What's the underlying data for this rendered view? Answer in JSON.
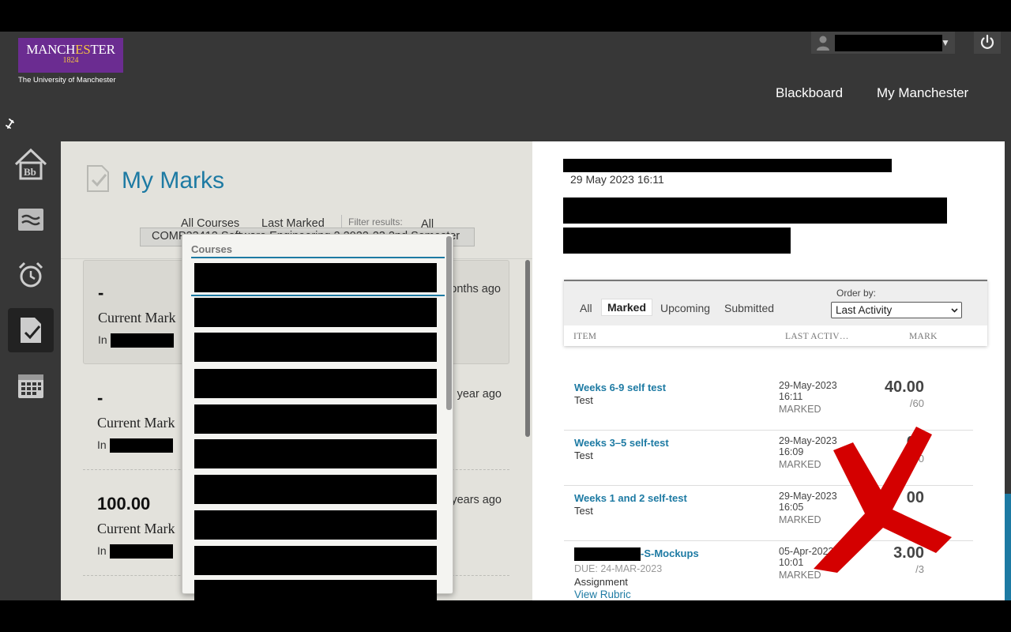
{
  "header": {
    "logo": {
      "main": "MANCHESTER",
      "year": "1824",
      "subtitle": "The University of Manchester"
    },
    "nav": {
      "blackboard": "Blackboard",
      "my_manchester": "My Manchester"
    }
  },
  "rail": {
    "items": [
      "home-icon",
      "stream-icon",
      "alarm-icon",
      "grades-icon",
      "calendar-icon"
    ],
    "active": "grades-icon"
  },
  "marks": {
    "title": "My Marks",
    "filters": {
      "all_courses": "All Courses",
      "last_marked": "Last Marked",
      "filter_label": "Filter results:",
      "filter_value": "All"
    },
    "course_select": "COMP23412 Software Engineering 2 2022-23 2nd Semester",
    "cards": [
      {
        "value": "-",
        "label": "Current Mark",
        "in": "In",
        "ago": "months ago"
      },
      {
        "value": "-",
        "label": "Current Mark",
        "in": "In",
        "ago": "year ago"
      },
      {
        "value": "100.00",
        "label": "Current Mark",
        "in": "In",
        "ago": "years ago"
      }
    ],
    "dropdown": {
      "title": "Courses"
    }
  },
  "detail": {
    "date": "29 May 2023 16:11",
    "tabs": {
      "all": "All",
      "marked": "Marked",
      "upcoming": "Upcoming",
      "submitted": "Submitted"
    },
    "order_by": {
      "label": "Order by:",
      "value": "Last Activity"
    },
    "columns": {
      "item": "ITEM",
      "last_activity": "LAST ACTIV…",
      "mark": "MARK"
    },
    "rows": [
      {
        "title": "Weeks 6-9 self test",
        "type": "Test",
        "date": "29-May-2023",
        "time": "16:11",
        "status": "MARKED",
        "score": "40.00",
        "out_of": "/60"
      },
      {
        "title": "Weeks 3–5 self-test",
        "type": "Test",
        "date": "29-May-2023",
        "time": "16:09",
        "status": "MARKED",
        "score": "00",
        "out_of": "/60"
      },
      {
        "title": "Weeks 1 and 2 self-test",
        "type": "Test",
        "date": "29-May-2023",
        "time": "16:05",
        "status": "MARKED",
        "score": "00",
        "out_of": ""
      },
      {
        "title": "-S-Mockups",
        "due": "DUE: 24-MAR-2023",
        "type": "Assignment",
        "rubric": "View Rubric",
        "date": "05-Apr-2023",
        "time": "10:01",
        "status": "MARKED",
        "score": "3.00",
        "out_of": "/3"
      }
    ]
  },
  "colors": {
    "accent": "#1d7aa3",
    "brand": "#6b2c91",
    "annotation": "#d40000"
  }
}
